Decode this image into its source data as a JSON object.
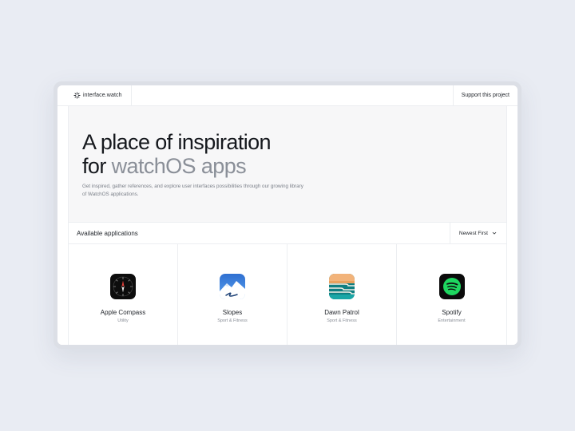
{
  "header": {
    "logo_text": "interface.watch",
    "support_label": "Support this project"
  },
  "hero": {
    "line1": "A place of inspiration",
    "line2_prefix": "for ",
    "line2_highlight": "watchOS apps",
    "description": "Get inspired, gather references, and explore user interfaces possibilities through our growing library of WatchOS applications."
  },
  "apps_section": {
    "title": "Available applications",
    "sort_label": "Newest First"
  },
  "apps": [
    {
      "name": "Apple Compass",
      "category": "Utility",
      "icon": "compass-icon"
    },
    {
      "name": "Slopes",
      "category": "Sport & Fitness",
      "icon": "mountain-icon"
    },
    {
      "name": "Dawn Patrol",
      "category": "Sport & Fitness",
      "icon": "waves-icon"
    },
    {
      "name": "Spotify",
      "category": "Entertainment",
      "icon": "spotify-icon"
    }
  ],
  "colors": {
    "background": "#e9ecf3",
    "hero_background": "#f7f7f8",
    "muted_text": "#8a8f98",
    "spotify_green": "#1ed760",
    "slopes_blue": "#3b7fd8",
    "dawn_patrol_teal": "#1aa6a6",
    "dawn_patrol_orange": "#e9a15e"
  }
}
